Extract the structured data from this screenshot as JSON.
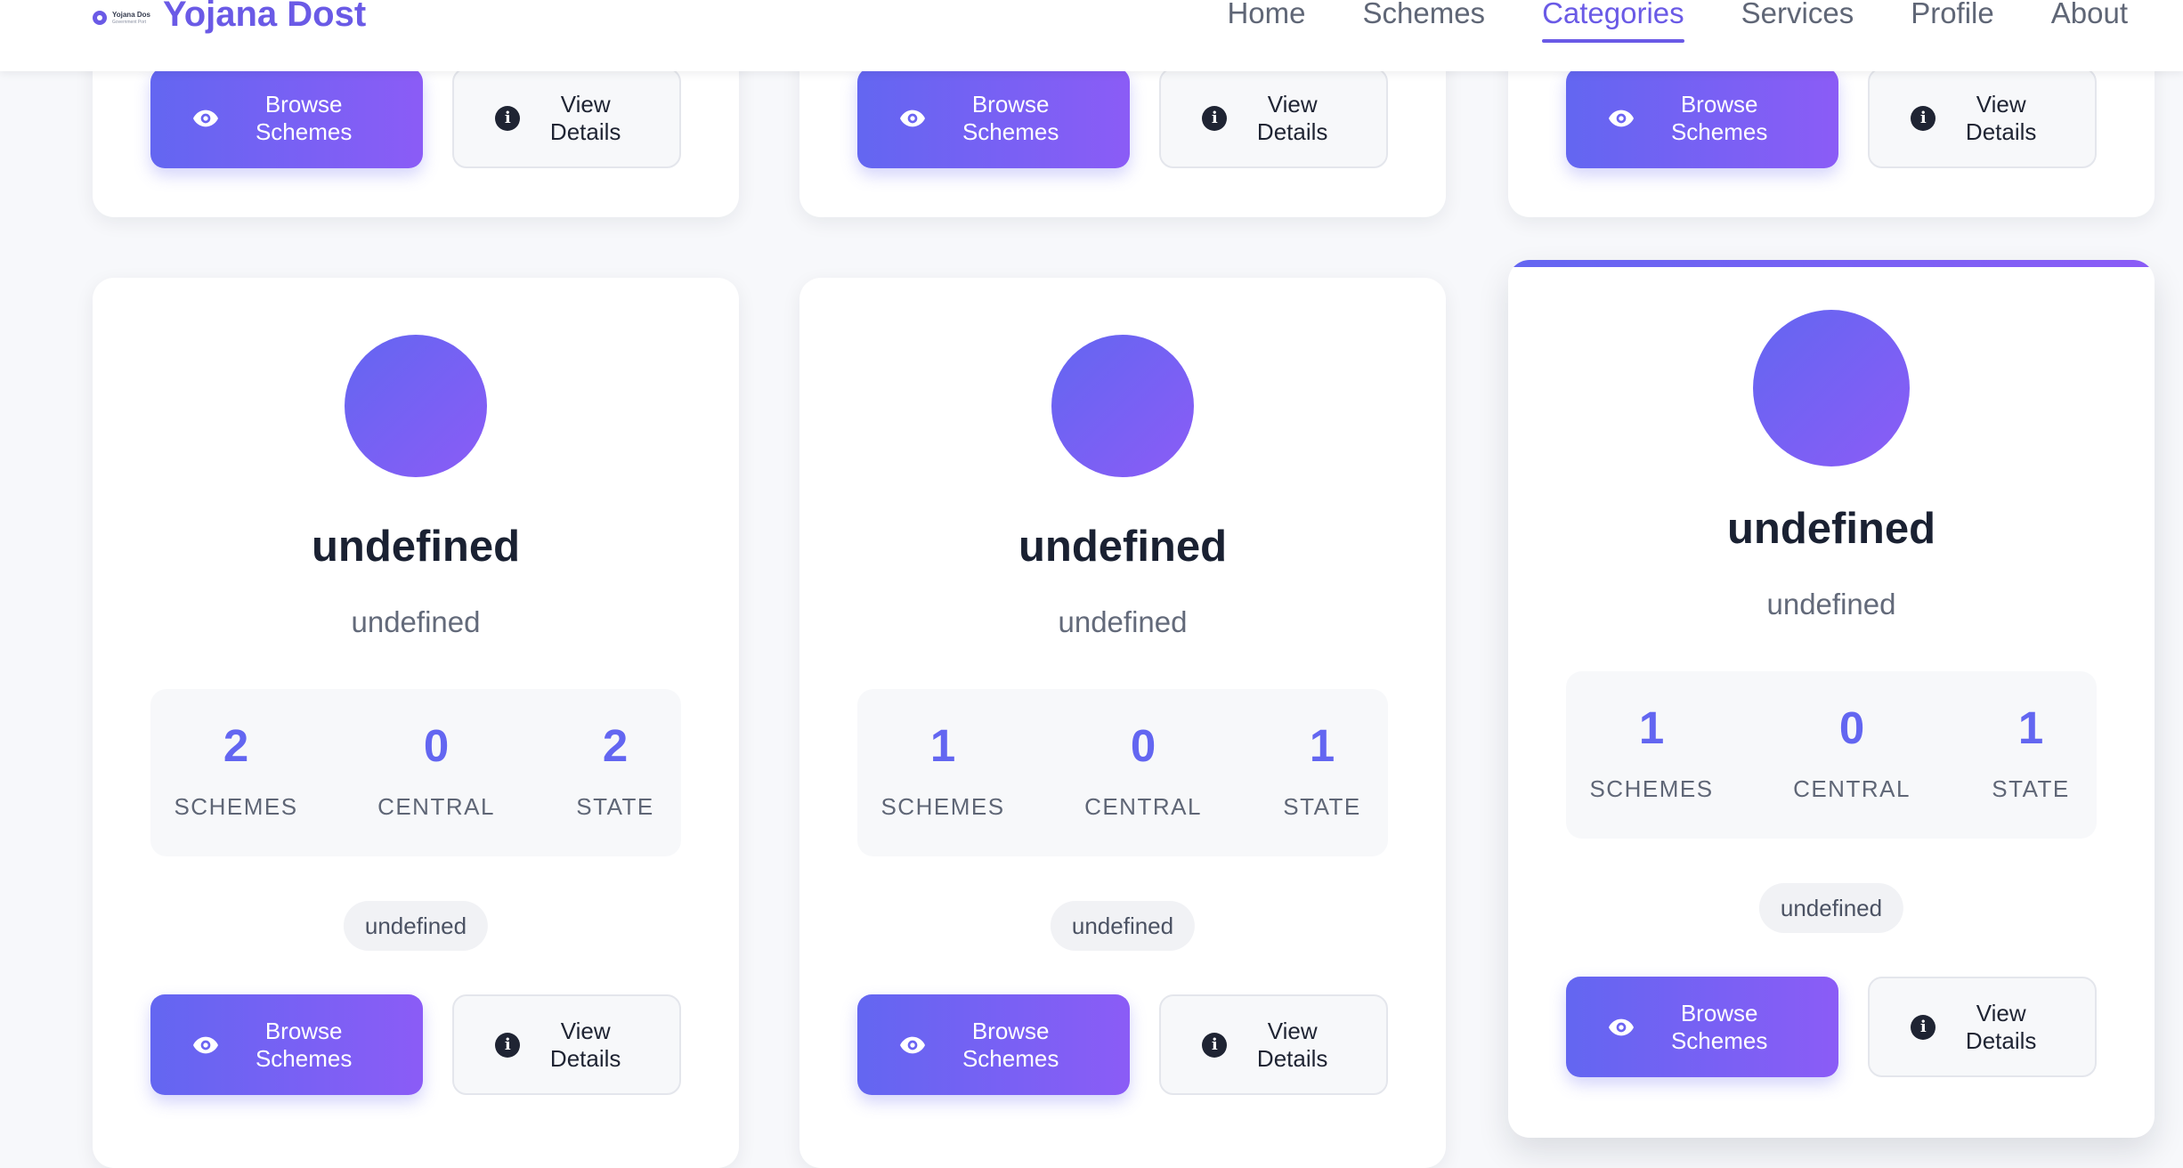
{
  "nav": {
    "brand_mini_title": "Yojana Dos",
    "brand_mini_sub": "Government Port",
    "brand_name": "Yojana Dost",
    "links": [
      "Home",
      "Schemes",
      "Categories",
      "Services",
      "Profile",
      "About"
    ],
    "active": "Categories"
  },
  "buttons": {
    "browse": "Browse\nSchemes",
    "view": "View\nDetails"
  },
  "cards": [
    {
      "title": "undefined",
      "desc": "undefined",
      "schemes": "2",
      "central": "0",
      "state": "2",
      "tag": "undefined"
    },
    {
      "title": "undefined",
      "desc": "undefined",
      "schemes": "1",
      "central": "0",
      "state": "1",
      "tag": "undefined"
    },
    {
      "title": "undefined",
      "desc": "undefined",
      "schemes": "1",
      "central": "0",
      "state": "1",
      "tag": "undefined"
    }
  ],
  "stat_labels": {
    "schemes": "SCHEMES",
    "central": "CENTRAL",
    "state": "STATE"
  },
  "colors": {
    "accent": "#6366f1",
    "accent_end": "#8b5cf6",
    "text": "#1f2433"
  },
  "icons": {
    "eye": "eye-icon",
    "info": "info-icon"
  }
}
